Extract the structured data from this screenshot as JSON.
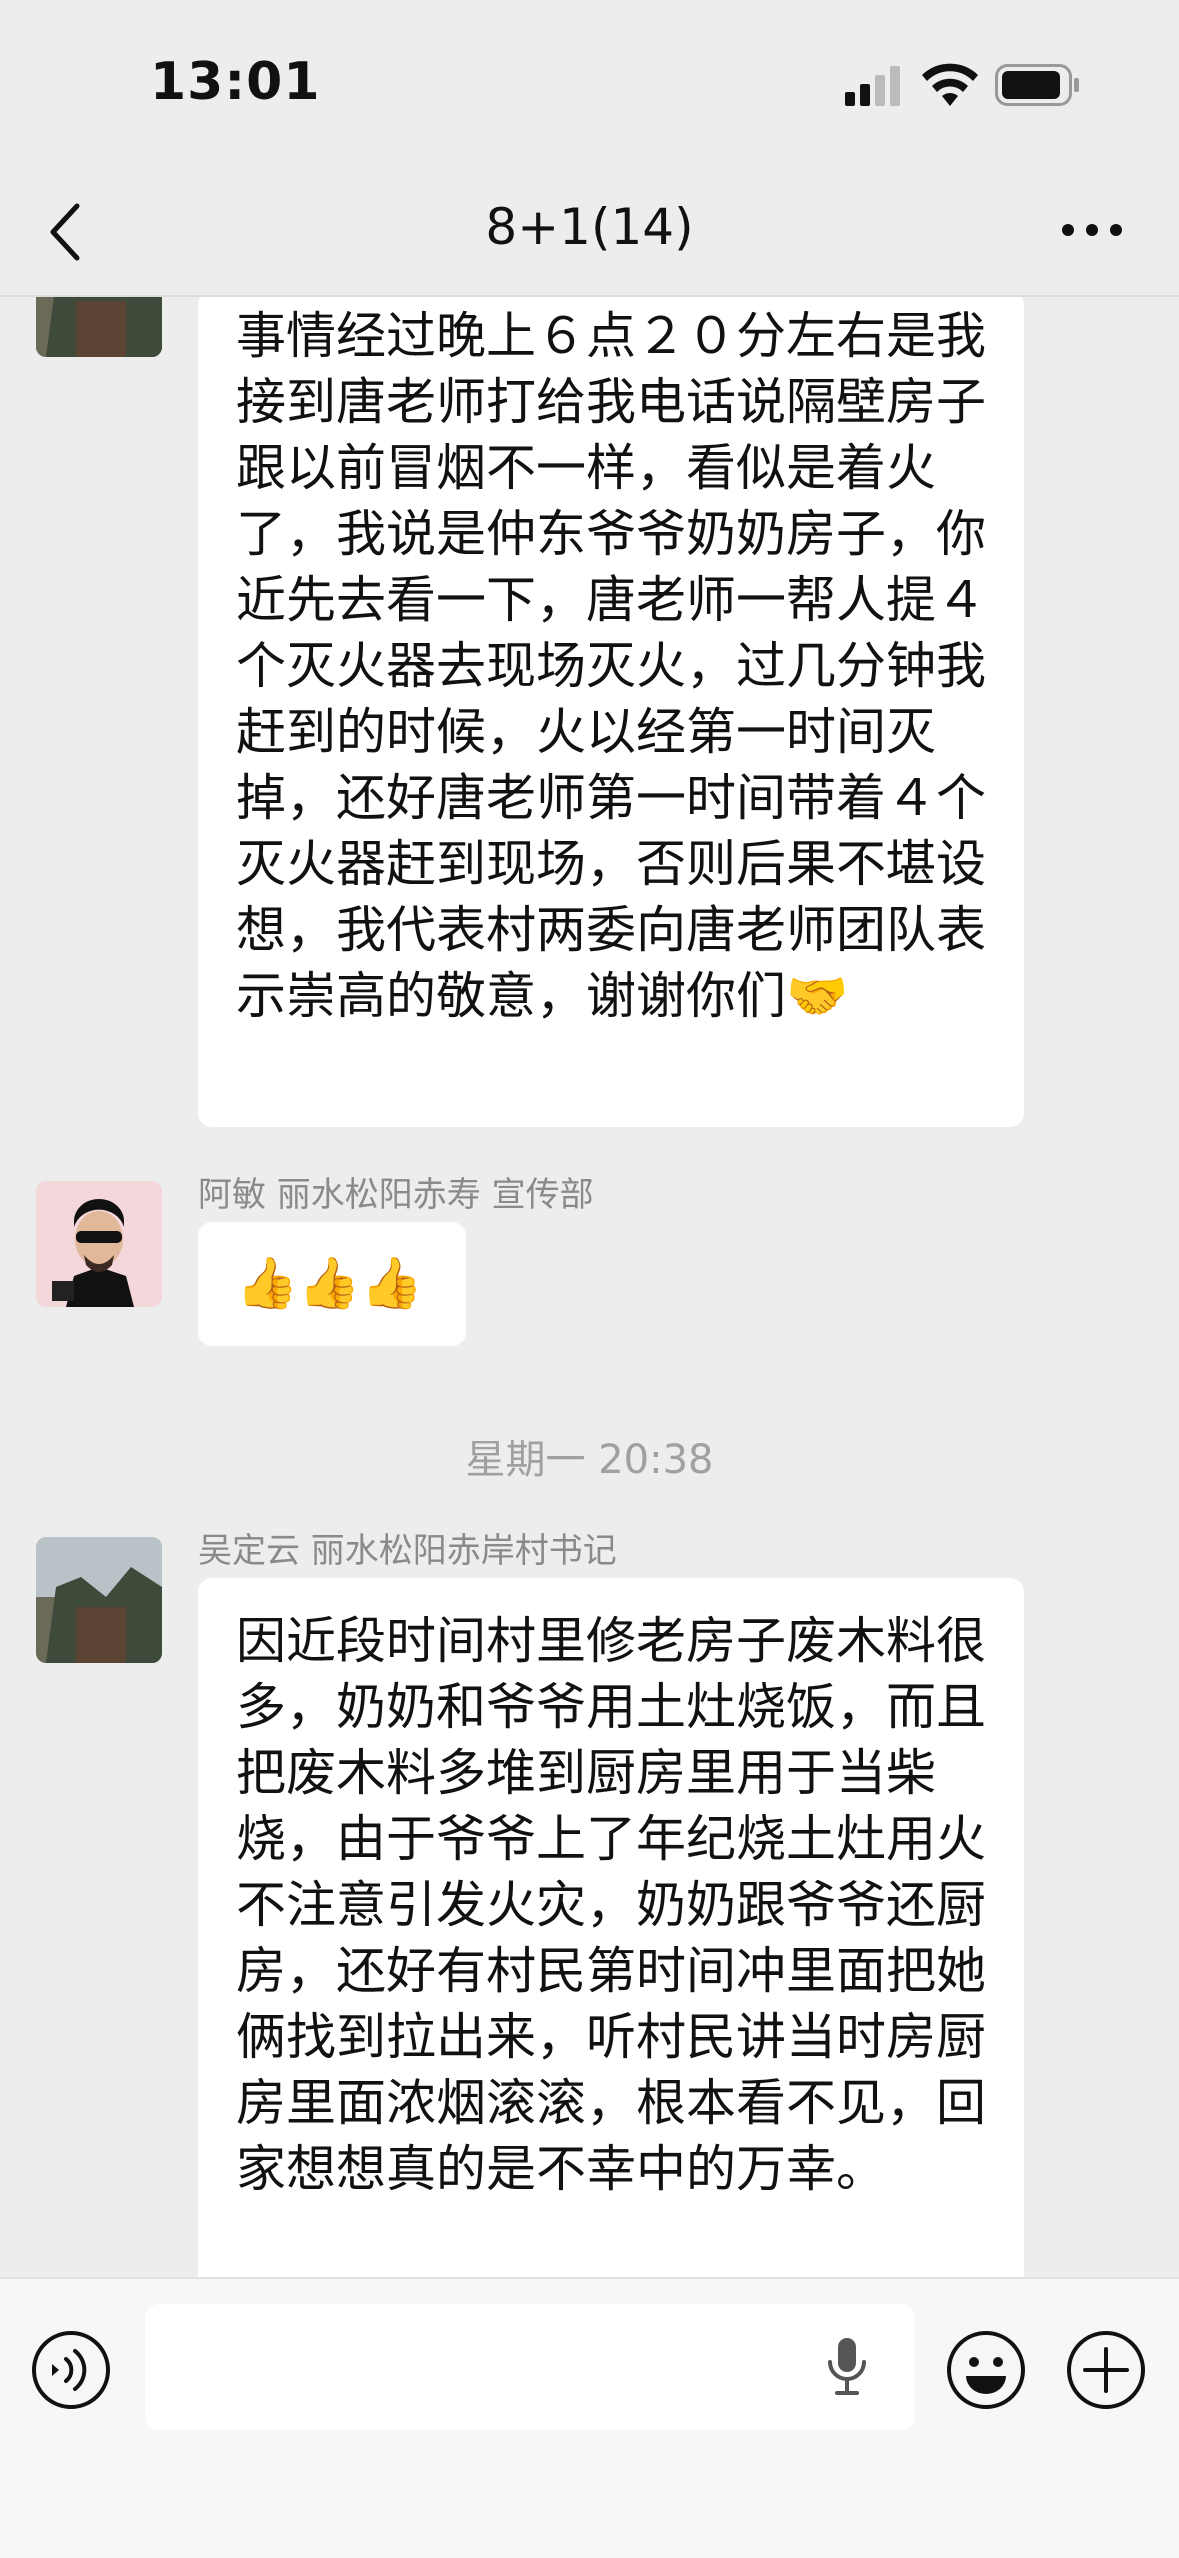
{
  "status": {
    "time": "13:01"
  },
  "nav": {
    "title": "8+1(14)"
  },
  "messages": [
    {
      "sender": "",
      "text": "事情经过晚上６点２０分左右是我接到唐老师打给我电话说隔壁房子跟以前冒烟不一样，看似是着火了，我说是仲东爷爷奶奶房子，你近先去看一下，唐老师一帮人提４个灭火器去现场灭火，过几分钟我赶到的时候，火以经第一时间灭掉，还好唐老师第一时间带着４个灭火器赶到现场，否则后果不堪设想，我代表村两委向唐老师团队表示崇高的敬意，谢谢你们🤝"
    },
    {
      "sender": "阿敏 丽水松阳赤寿 宣传部",
      "text": "👍👍👍"
    },
    {
      "sender": "吴定云 丽水松阳赤岸村书记",
      "text": "因近段时间村里修老房子废木料很多，奶奶和爷爷用土灶烧饭，而且把废木料多堆到厨房里用于当柴烧，由于爷爷上了年纪烧土灶用火不注意引发火灾，奶奶跟爷爷还厨房，还好有村民第时间冲里面把她俩找到拉出来，听村民讲当时房厨房里面浓烟滚滚，根本看不见，回家想想真的是不幸中的万幸。"
    }
  ],
  "timestamp": "星期一 20:38",
  "input": {
    "placeholder": ""
  }
}
